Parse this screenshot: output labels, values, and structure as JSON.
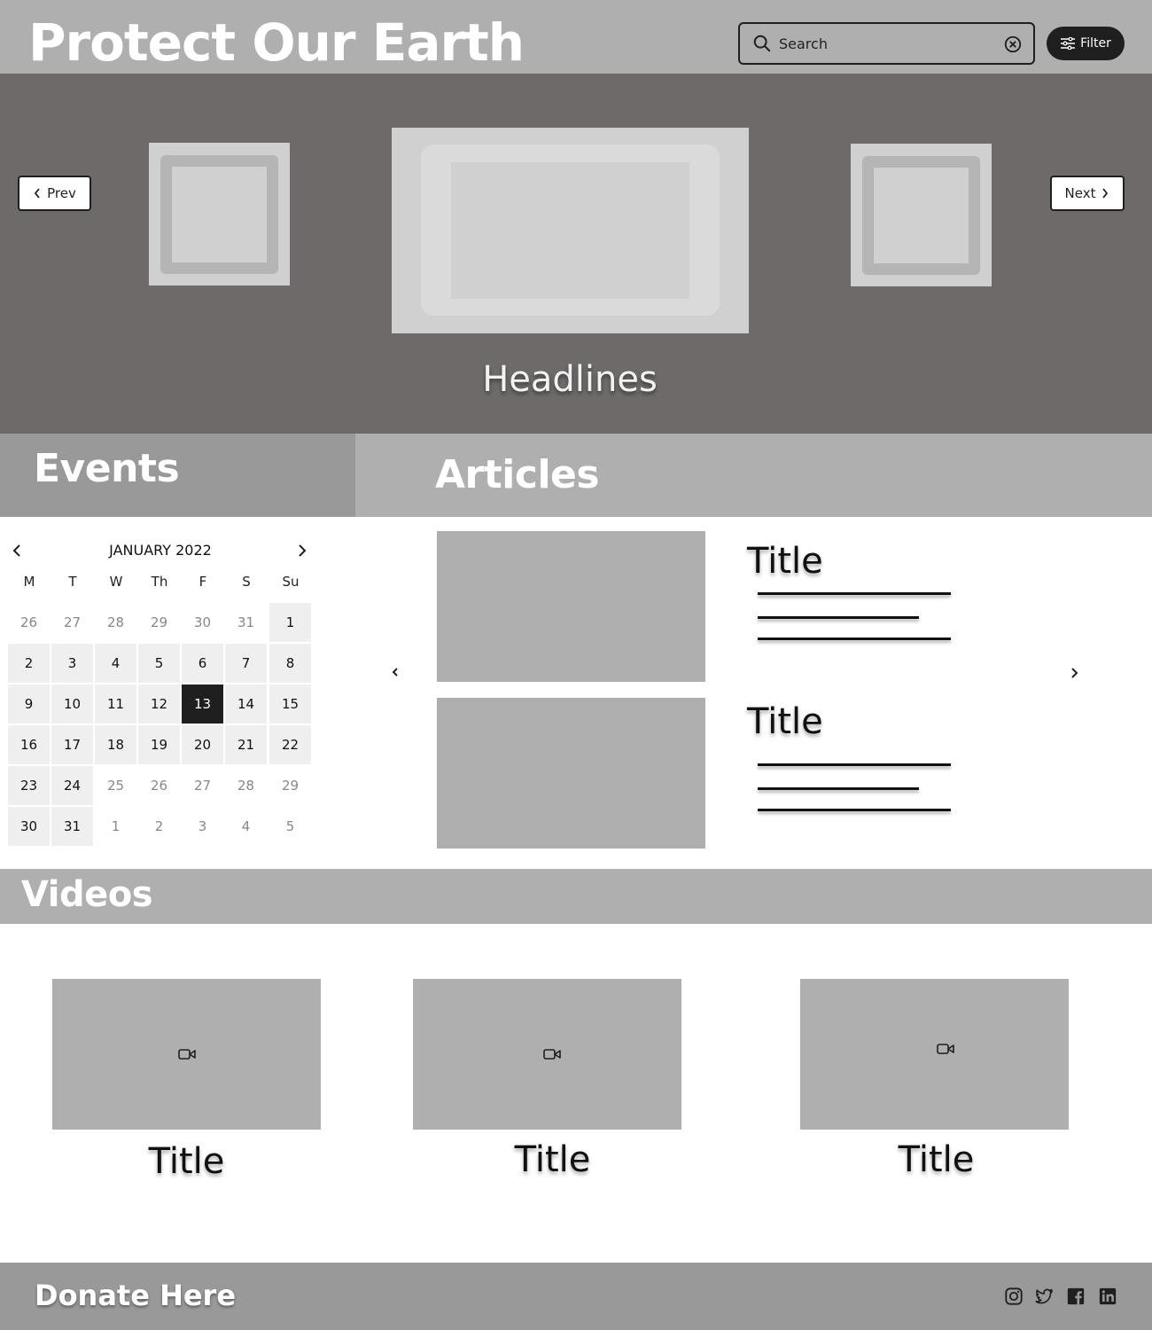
{
  "header": {
    "site_title": "Protect Our Earth",
    "search_placeholder": "Search",
    "search_value": "",
    "filter_label": "Filter"
  },
  "hero": {
    "prev_label": "Prev",
    "next_label": "Next",
    "caption": "Headlines"
  },
  "events": {
    "heading": "Events",
    "calendar": {
      "month_label": "JANUARY 2022",
      "weekdays": [
        "M",
        "T",
        "W",
        "Th",
        "F",
        "S",
        "Su"
      ],
      "weeks": [
        [
          "26",
          "27",
          "28",
          "29",
          "30",
          "31",
          "1"
        ],
        [
          "2",
          "3",
          "4",
          "5",
          "6",
          "7",
          "8"
        ],
        [
          "9",
          "10",
          "11",
          "12",
          "13",
          "14",
          "15"
        ],
        [
          "16",
          "17",
          "18",
          "19",
          "20",
          "21",
          "22"
        ],
        [
          "23",
          "24",
          "25",
          "26",
          "27",
          "28",
          "29"
        ],
        [
          "30",
          "31",
          "1",
          "2",
          "3",
          "4",
          "5"
        ]
      ],
      "selected_day": "13"
    }
  },
  "articles": {
    "heading": "Articles",
    "items": [
      {
        "title": "Title"
      },
      {
        "title": "Title"
      }
    ]
  },
  "videos": {
    "heading": "Videos",
    "items": [
      {
        "title": "Title",
        "icon": "video-camera-icon"
      },
      {
        "title": "Title",
        "icon": "video-camera-icon"
      },
      {
        "title": "Title",
        "icon": "video-camera-icon"
      }
    ]
  },
  "footer": {
    "donate_label": "Donate Here",
    "social": [
      "instagram-icon",
      "twitter-icon",
      "facebook-icon",
      "linkedin-icon"
    ]
  },
  "colors": {
    "header_bg": "#b0afb0",
    "hero_bg": "#6e6a6a",
    "events_bar_bg": "#9a999a",
    "selected_day_bg": "#1f1f1f",
    "placeholder_gray": "#b0afb0"
  }
}
